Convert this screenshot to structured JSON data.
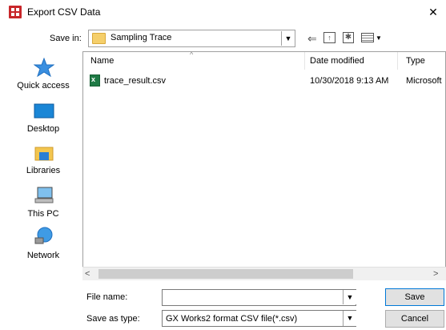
{
  "window": {
    "title": "Export CSV Data",
    "close_glyph": "✕"
  },
  "save_in": {
    "label": "Save in:",
    "value": "Sampling Trace"
  },
  "toolbar": {
    "back_icon": "back-arrow-icon",
    "up_icon": "up-folder-icon",
    "new_folder_icon": "new-folder-icon",
    "view_icon": "view-menu-icon"
  },
  "places": [
    {
      "label": "Quick access",
      "icon": "star-icon"
    },
    {
      "label": "Desktop",
      "icon": "desktop-icon"
    },
    {
      "label": "Libraries",
      "icon": "libraries-icon"
    },
    {
      "label": "This PC",
      "icon": "computer-icon"
    },
    {
      "label": "Network",
      "icon": "network-icon"
    }
  ],
  "file_list": {
    "columns": [
      "Name",
      "Date modified",
      "Type"
    ],
    "rows": [
      {
        "name": "trace_result.csv",
        "date": "10/30/2018 9:13 AM",
        "type": "Microsoft"
      }
    ]
  },
  "file_name": {
    "label": "File name:",
    "value": ""
  },
  "save_as_type": {
    "label": "Save as type:",
    "value": "GX Works2 format CSV file(*.csv)"
  },
  "buttons": {
    "save": "Save",
    "cancel": "Cancel"
  }
}
